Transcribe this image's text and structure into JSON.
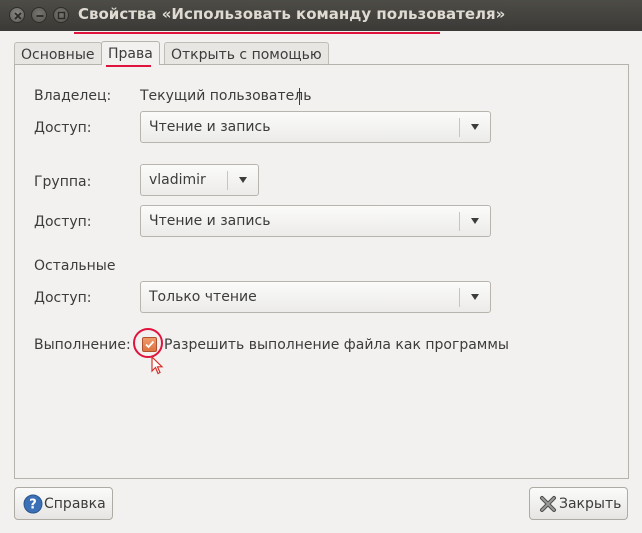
{
  "window": {
    "title": "Свойства «Использовать команду пользователя»"
  },
  "tabs": [
    {
      "label": "Основные"
    },
    {
      "label": "Права"
    },
    {
      "label": "Открыть с помощью"
    }
  ],
  "permissions": {
    "owner_label": "Владелец:",
    "owner_value": "Текущий пользователь",
    "owner_access_label": "Доступ:",
    "owner_access_value": "Чтение и запись",
    "group_label": "Группа:",
    "group_value": "vladimir",
    "group_access_label": "Доступ:",
    "group_access_value": "Чтение и запись",
    "others_label": "Остальные",
    "others_access_label": "Доступ:",
    "others_access_value": "Только чтение",
    "execute_label": "Выполнение:",
    "execute_checkbox_label": "Разрешить выполнение файла как программы",
    "execute_checked": true
  },
  "buttons": {
    "help": "Справка",
    "close": "Закрыть"
  },
  "colors": {
    "checkbox_fill": "#dd7340",
    "annotation": "#e0133c",
    "titlebar": "#3c3b37"
  },
  "icons": [
    "close-window-icon",
    "minimize-window-icon",
    "maximize-window-icon",
    "help-icon",
    "close-icon",
    "checkmark-icon",
    "mouse-cursor-icon"
  ]
}
